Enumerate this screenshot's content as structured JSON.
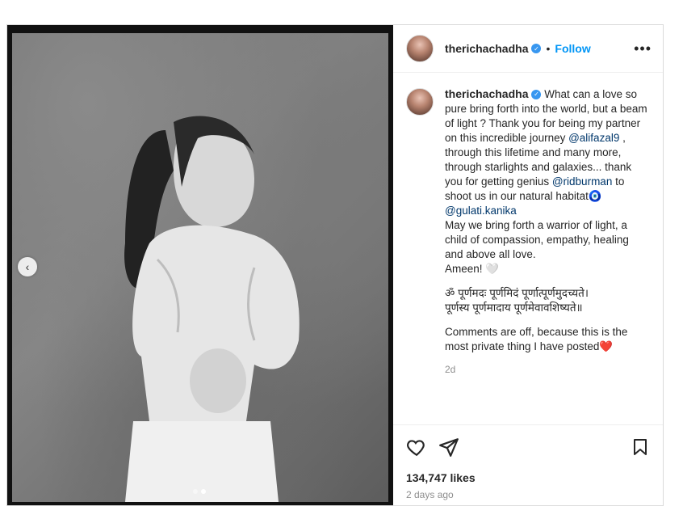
{
  "post": {
    "username": "therichachadha",
    "separator": "•",
    "follow_label": "Follow",
    "more_label": "•••",
    "prev_label": "‹",
    "carousel": {
      "slides": 2,
      "active": 2
    }
  },
  "caption": {
    "username": "therichachadha",
    "text_1": " What can a love so pure bring forth into the world, but a beam of light ? Thank you for being my partner on this incredible journey ",
    "mention_1": "@alifazal9",
    "text_2": " , through this lifetime and many more, through starlights and galaxies... thank you for getting genius ",
    "mention_2": "@ridburman",
    "text_3": " to shoot us in our natural habitat",
    "evil_eye": "🧿",
    "mention_3": "@gulati.kanika",
    "text_4": "May we bring forth a warrior of light, a child of compassion, empathy, healing and above all love.",
    "text_5": "Ameen! 🤍",
    "sanskrit_1": "ॐ पूर्णमदः पूर्णमिदं पूर्णात्पूर्णमुदच्यते।",
    "sanskrit_2": "पूर्णस्य पूर्णमादाय पूर्णमेवावशिष्यते॥",
    "text_6": "Comments are off, because this is the most private thing I have posted",
    "heart": "❤️",
    "time": "2d"
  },
  "footer": {
    "likes": "134,747 likes",
    "ago": "2 days ago"
  },
  "icons": {
    "like": "heart-outline-icon",
    "share": "paper-plane-icon",
    "save": "bookmark-icon",
    "verified": "verified-badge-icon"
  },
  "colors": {
    "follow": "#0095f6",
    "verified": "#3897f0",
    "mention": "#00376b",
    "muted": "#8e8e8e"
  }
}
